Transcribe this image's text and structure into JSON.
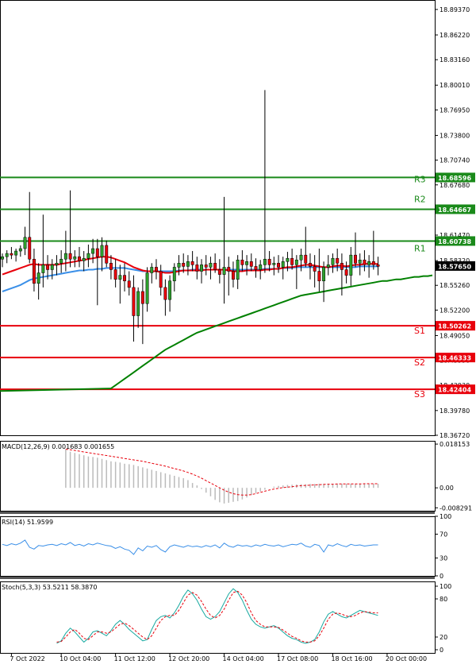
{
  "chart_data": [
    {
      "type": "candlestick",
      "panel": "price",
      "y_ticks": [
        "18.89370",
        "18.86220",
        "18.83160",
        "18.80010",
        "18.76950",
        "18.73800",
        "18.70740",
        "18.67680",
        "18.64530",
        "18.61470",
        "18.58320",
        "18.55260",
        "18.52200",
        "18.49050",
        "18.45990",
        "18.42930",
        "18.39780",
        "18.36720"
      ],
      "ylim": [
        18.3672,
        18.9054
      ],
      "x_labels": [
        "7 Oct 2022",
        "10 Oct 04:00",
        "11 Oct 12:00",
        "12 Oct 20:00",
        "14 Oct 04:00",
        "17 Oct 08:00",
        "18 Oct 16:00",
        "20 Oct 00:00"
      ],
      "x_label_bars": [
        2,
        13,
        25,
        37,
        49,
        61,
        73,
        85
      ],
      "x_count": 96,
      "last_price": "18.57650",
      "last_price_value": 18.5765,
      "levels": [
        {
          "label": "R3",
          "value": 18.68596,
          "value_text": "18.68596",
          "color": "#1a8a1a"
        },
        {
          "label": "R2",
          "value": 18.64667,
          "value_text": "18.64667",
          "color": "#1a8a1a"
        },
        {
          "label": "R1",
          "value": 18.60738,
          "value_text": "18.60738",
          "color": "#1a8a1a"
        },
        {
          "label": "S1",
          "value": 18.50262,
          "value_text": "18.50262",
          "color": "#e8000b"
        },
        {
          "label": "S2",
          "value": 18.46333,
          "value_text": "18.46333",
          "color": "#e8000b"
        },
        {
          "label": "S3",
          "value": 18.42404,
          "value_text": "18.42404",
          "color": "#e8000b"
        }
      ],
      "candles": [
        [
          18.585,
          18.592,
          18.575,
          18.588
        ],
        [
          18.588,
          18.596,
          18.58,
          18.592
        ],
        [
          18.592,
          18.6,
          18.585,
          18.59
        ],
        [
          18.59,
          18.598,
          18.582,
          18.595
        ],
        [
          18.595,
          18.602,
          18.588,
          18.598
        ],
        [
          18.598,
          18.625,
          18.59,
          18.612
        ],
        [
          18.612,
          18.668,
          18.58,
          18.585
        ],
        [
          18.585,
          18.598,
          18.545,
          18.555
        ],
        [
          18.555,
          18.58,
          18.535,
          18.568
        ],
        [
          18.568,
          18.64,
          18.55,
          18.578
        ],
        [
          18.578,
          18.59,
          18.56,
          18.572
        ],
        [
          18.572,
          18.585,
          18.56,
          18.578
        ],
        [
          18.578,
          18.59,
          18.565,
          18.58
        ],
        [
          18.58,
          18.596,
          18.568,
          18.585
        ],
        [
          18.585,
          18.62,
          18.57,
          18.592
        ],
        [
          18.592,
          18.67,
          18.575,
          18.585
        ],
        [
          18.585,
          18.596,
          18.575,
          18.588
        ],
        [
          18.588,
          18.6,
          18.575,
          18.583
        ],
        [
          18.583,
          18.595,
          18.57,
          18.586
        ],
        [
          18.586,
          18.603,
          18.575,
          18.592
        ],
        [
          18.592,
          18.61,
          18.58,
          18.598
        ],
        [
          18.598,
          18.61,
          18.528,
          18.588
        ],
        [
          18.588,
          18.612,
          18.57,
          18.602
        ],
        [
          18.602,
          18.608,
          18.575,
          18.58
        ],
        [
          18.58,
          18.59,
          18.56,
          18.572
        ],
        [
          18.572,
          18.585,
          18.55,
          18.56
        ],
        [
          18.56,
          18.578,
          18.53,
          18.565
        ],
        [
          18.565,
          18.58,
          18.545,
          18.558
        ],
        [
          18.558,
          18.57,
          18.54,
          18.55
        ],
        [
          18.55,
          18.565,
          18.483,
          18.515
        ],
        [
          18.515,
          18.55,
          18.5,
          18.545
        ],
        [
          18.545,
          18.56,
          18.48,
          18.53
        ],
        [
          18.53,
          18.575,
          18.52,
          18.568
        ],
        [
          18.568,
          18.58,
          18.555,
          18.575
        ],
        [
          18.575,
          18.585,
          18.56,
          18.57
        ],
        [
          18.57,
          18.578,
          18.54,
          18.55
        ],
        [
          18.55,
          18.56,
          18.515,
          18.535
        ],
        [
          18.535,
          18.565,
          18.52,
          18.558
        ],
        [
          18.558,
          18.58,
          18.545,
          18.575
        ],
        [
          18.575,
          18.59,
          18.565,
          18.58
        ],
        [
          18.58,
          18.592,
          18.568,
          18.576
        ],
        [
          18.576,
          18.59,
          18.565,
          18.582
        ],
        [
          18.582,
          18.595,
          18.57,
          18.578
        ],
        [
          18.578,
          18.588,
          18.56,
          18.57
        ],
        [
          18.57,
          18.585,
          18.555,
          18.578
        ],
        [
          18.578,
          18.59,
          18.565,
          18.575
        ],
        [
          18.575,
          18.588,
          18.56,
          18.58
        ],
        [
          18.58,
          18.592,
          18.568,
          18.572
        ],
        [
          18.572,
          18.585,
          18.555,
          18.566
        ],
        [
          18.566,
          18.662,
          18.53,
          18.575
        ],
        [
          18.575,
          18.588,
          18.54,
          18.57
        ],
        [
          18.57,
          18.582,
          18.55,
          18.56
        ],
        [
          18.56,
          18.59,
          18.548,
          18.584
        ],
        [
          18.584,
          18.596,
          18.57,
          18.578
        ],
        [
          18.578,
          18.59,
          18.565,
          18.582
        ],
        [
          18.582,
          18.592,
          18.57,
          18.576
        ],
        [
          18.576,
          18.586,
          18.562,
          18.572
        ],
        [
          18.572,
          18.584,
          18.56,
          18.578
        ],
        [
          18.578,
          18.794,
          18.568,
          18.585
        ],
        [
          18.585,
          18.595,
          18.57,
          18.578
        ],
        [
          18.578,
          18.588,
          18.565,
          18.58
        ],
        [
          18.58,
          18.59,
          18.568,
          18.575
        ],
        [
          18.575,
          18.588,
          18.56,
          18.582
        ],
        [
          18.582,
          18.594,
          18.57,
          18.586
        ],
        [
          18.586,
          18.598,
          18.572,
          18.578
        ],
        [
          18.578,
          18.59,
          18.548,
          18.584
        ],
        [
          18.584,
          18.598,
          18.57,
          18.59
        ],
        [
          18.59,
          18.625,
          18.575,
          18.58
        ],
        [
          18.58,
          18.592,
          18.56,
          18.576
        ],
        [
          18.576,
          18.59,
          18.55,
          18.57
        ],
        [
          18.57,
          18.598,
          18.545,
          18.558
        ],
        [
          18.558,
          18.582,
          18.532,
          18.575
        ],
        [
          18.575,
          18.59,
          18.565,
          18.578
        ],
        [
          18.578,
          18.592,
          18.568,
          18.586
        ],
        [
          18.586,
          18.598,
          18.57,
          18.58
        ],
        [
          18.58,
          18.592,
          18.54,
          18.572
        ],
        [
          18.572,
          18.582,
          18.555,
          18.565
        ],
        [
          18.565,
          18.6,
          18.552,
          18.59
        ],
        [
          18.59,
          18.618,
          18.575,
          18.58
        ],
        [
          18.58,
          18.592,
          18.565,
          18.584
        ],
        [
          18.584,
          18.596,
          18.57,
          18.578
        ],
        [
          18.578,
          18.59,
          18.562,
          18.582
        ],
        [
          18.582,
          18.62,
          18.572,
          18.578
        ],
        [
          18.578,
          18.588,
          18.565,
          18.576
        ]
      ],
      "ma_red": [
        18.566,
        18.568,
        18.57,
        18.572,
        18.574,
        18.576,
        18.578,
        18.579,
        18.578,
        18.578,
        18.578,
        18.578,
        18.578,
        18.579,
        18.58,
        18.581,
        18.582,
        18.583,
        18.584,
        18.585,
        18.586,
        18.587,
        18.588,
        18.588,
        18.587,
        18.585,
        18.583,
        18.581,
        18.578,
        18.575,
        18.573,
        18.571,
        18.57,
        18.57,
        18.57,
        18.569,
        18.568,
        18.568,
        18.569,
        18.57,
        18.571,
        18.571,
        18.571,
        18.571,
        18.571,
        18.572,
        18.572,
        18.572,
        18.572,
        18.572,
        18.571,
        18.57,
        18.57,
        18.57,
        18.571,
        18.571,
        18.571,
        18.571,
        18.572,
        18.572,
        18.573,
        18.573,
        18.574,
        18.575,
        18.575,
        18.576,
        18.577,
        18.578,
        18.578,
        18.577,
        18.576,
        18.575,
        18.575,
        18.576,
        18.577,
        18.577,
        18.576,
        18.577,
        18.578,
        18.578,
        18.579,
        18.579,
        18.579,
        18.579
      ],
      "ma_blue": [
        18.545,
        18.547,
        18.549,
        18.551,
        18.553,
        18.556,
        18.559,
        18.561,
        18.562,
        18.563,
        18.564,
        18.565,
        18.566,
        18.567,
        18.568,
        18.569,
        18.57,
        18.571,
        18.571,
        18.572,
        18.572,
        18.573,
        18.573,
        18.574,
        18.574,
        18.574,
        18.574,
        18.574,
        18.573,
        18.572,
        18.571,
        18.57,
        18.57,
        18.57,
        18.57,
        18.57,
        18.57,
        18.57,
        18.57,
        18.571,
        18.571,
        18.571,
        18.572,
        18.572,
        18.572,
        18.572,
        18.572,
        18.572,
        18.572,
        18.572,
        18.572,
        18.572,
        18.572,
        18.572,
        18.572,
        18.572,
        18.572,
        18.572,
        18.573,
        18.573,
        18.573,
        18.573,
        18.574,
        18.574,
        18.574,
        18.575,
        18.575,
        18.575,
        18.575,
        18.575,
        18.575,
        18.575,
        18.575,
        18.575,
        18.575,
        18.575,
        18.575,
        18.575,
        18.575,
        18.576,
        18.576,
        18.576,
        18.576,
        18.576
      ],
      "ma_green_start": 18.425,
      "ma_green": [
        18.425,
        18.429,
        18.433,
        18.437,
        18.441,
        18.445,
        18.449,
        18.453,
        18.457,
        18.461,
        18.465,
        18.469,
        18.473,
        18.476,
        18.479,
        18.482,
        18.485,
        18.488,
        18.491,
        18.494,
        18.496,
        18.498,
        18.5,
        18.502,
        18.504,
        18.506,
        18.508,
        18.51,
        18.512,
        18.514,
        18.516,
        18.518,
        18.52,
        18.522,
        18.524,
        18.526,
        18.528,
        18.53,
        18.532,
        18.534,
        18.536,
        18.538,
        18.54,
        18.541,
        18.542,
        18.543,
        18.544,
        18.545,
        18.546,
        18.547,
        18.548,
        18.549,
        18.55,
        18.551,
        18.552,
        18.553,
        18.554,
        18.555,
        18.556,
        18.557,
        18.558,
        18.558,
        18.559,
        18.56,
        18.56,
        18.561,
        18.562,
        18.563,
        18.563,
        18.564,
        18.564,
        18.565
      ]
    },
    {
      "type": "bar+line",
      "panel": "macd",
      "label": "MACD(12,26,9) 0.001683 0.001655",
      "y_ticks": [
        "0.018153",
        "0.00",
        "-0.008291"
      ],
      "ylim": [
        -0.0095,
        0.0195
      ],
      "histogram": [
        0.016,
        0.015,
        0.0145,
        0.014,
        0.0135,
        0.013,
        0.0128,
        0.0125,
        0.012,
        0.0115,
        0.011,
        0.0108,
        0.0105,
        0.01,
        0.0098,
        0.0095,
        0.009,
        0.0085,
        0.008,
        0.0075,
        0.007,
        0.0065,
        0.006,
        0.0055,
        0.005,
        0.0045,
        0.004,
        0.0032,
        0.002,
        0.001,
        -0.0005,
        -0.002,
        -0.0035,
        -0.005,
        -0.006,
        -0.0065,
        -0.0062,
        -0.0058,
        -0.0055,
        -0.0048,
        -0.004,
        -0.003,
        -0.0022,
        -0.0015,
        -0.0008,
        0.0,
        0.0005,
        0.0008,
        0.001,
        0.0012,
        0.0013,
        0.0014,
        0.0015,
        0.0015,
        0.0016,
        0.0016,
        0.0017,
        0.0017,
        0.0017,
        0.0017,
        0.0017,
        0.0017,
        0.0017,
        0.0017,
        0.0017,
        0.0017,
        0.0017,
        0.0017,
        0.0017,
        0.0017
      ],
      "signal": [
        0.016,
        0.0158,
        0.0155,
        0.0152,
        0.0149,
        0.0146,
        0.0143,
        0.014,
        0.0137,
        0.0134,
        0.0131,
        0.0128,
        0.0125,
        0.0122,
        0.0119,
        0.0116,
        0.0113,
        0.011,
        0.0106,
        0.0102,
        0.0098,
        0.0094,
        0.009,
        0.0085,
        0.008,
        0.0075,
        0.007,
        0.0064,
        0.0057,
        0.0049,
        0.004,
        0.003,
        0.002,
        0.001,
        0.0,
        -0.001,
        -0.0018,
        -0.0024,
        -0.0028,
        -0.003,
        -0.003,
        -0.0028,
        -0.0024,
        -0.0019,
        -0.0014,
        -0.0009,
        -0.0005,
        -0.0002,
        0.0001,
        0.0003,
        0.0005,
        0.0007,
        0.0009,
        0.001,
        0.0011,
        0.0012,
        0.0013,
        0.0014,
        0.0015,
        0.0015,
        0.0016,
        0.0016,
        0.0016,
        0.0016,
        0.0016,
        0.0016,
        0.0017,
        0.0017,
        0.0017,
        0.0017
      ]
    },
    {
      "type": "line",
      "panel": "rsi",
      "label": "RSI(14) 51.9599",
      "y_ticks": [
        "100",
        "70",
        "30",
        "0"
      ],
      "ylim": [
        0,
        100
      ],
      "values": [
        53,
        51,
        54,
        52,
        55,
        60,
        48,
        45,
        51,
        50,
        52,
        53,
        51,
        54,
        52,
        56,
        51,
        53,
        50,
        54,
        52,
        55,
        53,
        51,
        50,
        46,
        49,
        45,
        43,
        36,
        47,
        42,
        50,
        48,
        51,
        44,
        40,
        49,
        52,
        50,
        48,
        51,
        49,
        50,
        48,
        51,
        49,
        52,
        47,
        55,
        50,
        48,
        52,
        50,
        51,
        49,
        52,
        50,
        53,
        51,
        50,
        52,
        49,
        51,
        53,
        52,
        55,
        50,
        48,
        53,
        51,
        40,
        52,
        50,
        54,
        51,
        49,
        53,
        51,
        52,
        50,
        51,
        52,
        52
      ]
    },
    {
      "type": "line",
      "panel": "stoch",
      "label": "Stoch(5,3,3) 53.5211 58.3870",
      "y_ticks": [
        "100",
        "80",
        "20",
        "0"
      ],
      "ylim": [
        0,
        100
      ],
      "x_labels": [
        "7 Oct 2022",
        "10 Oct 04:00",
        "11 Oct 12:00",
        "12 Oct 20:00",
        "14 Oct 04:00",
        "17 Oct 08:00",
        "18 Oct 16:00",
        "20 Oct 00:00"
      ],
      "k": [
        10,
        14,
        26,
        34,
        28,
        20,
        12,
        18,
        28,
        30,
        26,
        22,
        30,
        40,
        46,
        40,
        32,
        26,
        20,
        14,
        16,
        32,
        46,
        52,
        54,
        50,
        58,
        70,
        84,
        94,
        88,
        78,
        64,
        52,
        48,
        52,
        60,
        74,
        88,
        96,
        90,
        78,
        62,
        48,
        40,
        36,
        34,
        36,
        38,
        34,
        28,
        22,
        18,
        16,
        12,
        10,
        12,
        16,
        28,
        44,
        56,
        60,
        56,
        52,
        50,
        54,
        58,
        62,
        60,
        58,
        56,
        54
      ],
      "d": [
        12,
        13,
        20,
        28,
        32,
        26,
        18,
        16,
        22,
        28,
        28,
        26,
        28,
        34,
        40,
        42,
        38,
        32,
        26,
        20,
        16,
        22,
        34,
        46,
        52,
        54,
        54,
        62,
        74,
        86,
        90,
        86,
        76,
        64,
        54,
        50,
        54,
        64,
        78,
        90,
        92,
        86,
        74,
        58,
        46,
        40,
        36,
        36,
        36,
        35,
        31,
        26,
        21,
        18,
        14,
        12,
        12,
        14,
        22,
        34,
        48,
        56,
        58,
        56,
        53,
        52,
        54,
        58,
        60,
        59,
        58,
        58
      ]
    }
  ]
}
